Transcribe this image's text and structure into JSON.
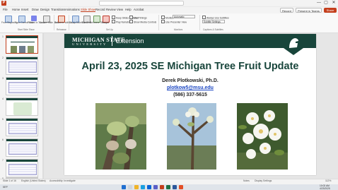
{
  "titlebar": {
    "app_logo": "P",
    "window_controls": [
      "—",
      "▢",
      "✕"
    ]
  },
  "ribbon_tabs": [
    "File",
    "Home",
    "Insert",
    "Draw",
    "Design",
    "Transitions",
    "Animations",
    "Slide Show",
    "Record",
    "Review",
    "View",
    "Help",
    "Acrobat"
  ],
  "active_tab": "Slide Show",
  "tab_actions": {
    "record": "Record",
    "present": "Present in Teams",
    "share": "Share"
  },
  "ribbon": {
    "buttons": [
      {
        "label": "From Beginning",
        "icon": "slideshow-begin-icon"
      },
      {
        "label": "From Current Slide",
        "icon": "slideshow-current-icon"
      },
      {
        "label": "Present in Teams",
        "icon": "teams-icon"
      },
      {
        "label": "Custom Slide Show",
        "icon": "custom-show-icon"
      },
      {
        "label": "Rehearse with Coach",
        "icon": "coach-icon"
      },
      {
        "label": "Set Up Slide Show",
        "icon": "setup-icon"
      },
      {
        "label": "Hide Slide",
        "icon": "hide-slide-icon"
      },
      {
        "label": "Rehearse Timings",
        "icon": "timer-icon"
      },
      {
        "label": "Record",
        "icon": "record-icon"
      }
    ],
    "checkboxes_setup": [
      "Keep Slides Updated",
      "Play Narrations",
      "Use Timings",
      "Show Media Controls"
    ],
    "checkboxes_monitors": [
      "Use Presenter View"
    ],
    "monitor_label": "Monitor:",
    "monitor_value": "Automatic",
    "checkboxes_captions": [
      "Always Use Subtitles"
    ],
    "subtitle_settings": "Subtitle Settings",
    "group_labels": [
      "Start Slide Show",
      "Rehearse",
      "Set Up",
      "Monitors",
      "Captions & Subtitles"
    ]
  },
  "thumbnails": [
    {
      "num": "1"
    },
    {
      "num": "2"
    },
    {
      "num": "3"
    },
    {
      "num": "4"
    },
    {
      "num": "5"
    },
    {
      "num": "6"
    },
    {
      "num": "7"
    },
    {
      "num": "8"
    }
  ],
  "slide": {
    "brand": "MICHIGAN STATE",
    "brand_sub": "UNIVERSITY",
    "extension": "Extension",
    "title": "April 23, 2025 SE Michigan Tree Fruit Update",
    "author": "Derek Plotkowski, Ph.D.",
    "email": "plotkow5@msu.edu",
    "phone": "(586) 337-5615"
  },
  "statusbar": {
    "slide_count": "Slide 1 of 16",
    "language": "English (United States)",
    "accessibility": "Accessibility: Investigate",
    "notes": "Notes",
    "display_settings": "Display Settings",
    "zoom": "112%"
  },
  "taskbar": {
    "weather": "55°F",
    "time": "10:02 AM",
    "date": "4/23/2025"
  },
  "colors": {
    "msu_green": "#18453b",
    "powerpoint_accent": "#c43e1c",
    "link_blue": "#1b46c2"
  }
}
